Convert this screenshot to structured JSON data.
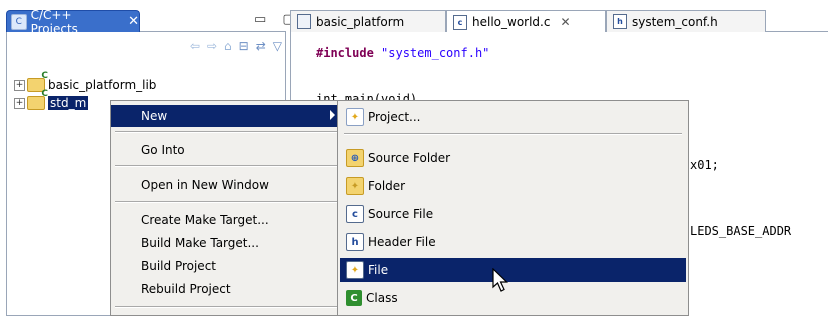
{
  "left_view": {
    "tab_title": "C/C++ Projects",
    "close_glyph": "✕",
    "window_controls": "▭ ▢",
    "toolbar_icons": [
      "back-icon",
      "forward-icon",
      "up-icon",
      "collapse-all-icon",
      "link-editor-icon",
      "view-menu-icon"
    ],
    "tree": [
      {
        "label": "basic_platform_lib",
        "expander": "+"
      },
      {
        "label": "std_m",
        "expander": "+",
        "selected": true
      }
    ]
  },
  "editor": {
    "tabs": [
      {
        "label": "basic_platform",
        "icon": "file-icon"
      },
      {
        "label": "hello_world.c",
        "close": "✕",
        "icon": "c-file-icon",
        "active": true
      },
      {
        "label": "system_conf.h",
        "icon": "h-file-icon"
      }
    ],
    "code": {
      "include_kw": "#include",
      "include_str": "\"system_conf.h\"",
      "line2": "int main(void)",
      "line3_tail": "x01;",
      "line4_tail": "LEDS_BASE_ADDR"
    }
  },
  "context_menu": {
    "items": [
      "New",
      "Go Into",
      "Open in New Window",
      "Create Make Target...",
      "Build Make Target...",
      "Build Project",
      "Rebuild Project"
    ]
  },
  "submenu": {
    "items": [
      "Project...",
      "Source Folder",
      "Folder",
      "Source File",
      "Header File",
      "File",
      "Class"
    ],
    "icon_glyphs": [
      "✦",
      "⊕",
      "✦",
      "c",
      "h",
      "✦",
      "C"
    ]
  },
  "colors": {
    "menu_highlight": "#0a246a",
    "active_view_tab": "#3a6fcb",
    "menu_bg": "#f1f0ed"
  }
}
